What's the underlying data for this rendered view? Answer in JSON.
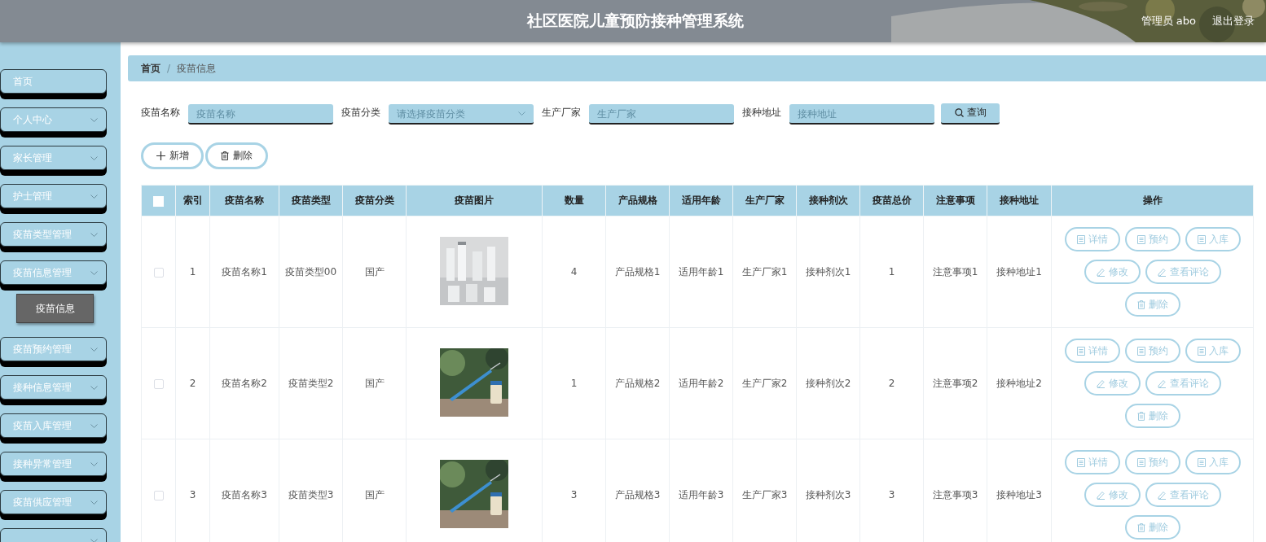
{
  "header": {
    "title": "社区医院儿童预防接种管理系统",
    "user": "管理员 abo",
    "logout": "退出登录"
  },
  "sidebar": {
    "items": [
      {
        "label": "首页",
        "kind": "link"
      },
      {
        "label": "个人中心",
        "kind": "menu"
      },
      {
        "label": "家长管理",
        "kind": "menu"
      },
      {
        "label": "护士管理",
        "kind": "menu"
      },
      {
        "label": "疫苗类型管理",
        "kind": "menu"
      },
      {
        "label": "疫苗信息管理",
        "kind": "menu",
        "children": [
          {
            "label": "疫苗信息",
            "selected": true
          }
        ]
      },
      {
        "label": "疫苗预约管理",
        "kind": "menu"
      },
      {
        "label": "接种信息管理",
        "kind": "menu"
      },
      {
        "label": "疫苗入库管理",
        "kind": "menu"
      },
      {
        "label": "接种异常管理",
        "kind": "menu"
      },
      {
        "label": "疫苗供应管理",
        "kind": "menu"
      },
      {
        "kind": "menu"
      }
    ]
  },
  "breadcrumb": {
    "items": [
      "首页",
      "疫苗信息"
    ],
    "separator": "/"
  },
  "search": {
    "fields": [
      {
        "label": "疫苗名称",
        "placeholder": "疫苗名称",
        "kind": "text"
      },
      {
        "label": "疫苗分类",
        "placeholder": "请选择疫苗分类",
        "kind": "select"
      },
      {
        "label": "生产厂家",
        "placeholder": "生产厂家",
        "kind": "text"
      },
      {
        "label": "接种地址",
        "placeholder": "接种地址",
        "kind": "text"
      }
    ],
    "button": "查询"
  },
  "toolbar": [
    {
      "label": "新增",
      "kind": "plus"
    },
    {
      "label": "删除",
      "kind": "trash"
    }
  ],
  "table": {
    "columns": [
      "索引",
      "疫苗名称",
      "疫苗类型",
      "疫苗分类",
      "疫苗图片",
      "数量",
      "产品规格",
      "适用年龄",
      "生产厂家",
      "接种剂次",
      "疫苗总价",
      "注意事项",
      "接种地址",
      "操作"
    ],
    "select_all": {
      "checked": false
    },
    "rows": [
      {
        "checked": false,
        "cells": [
          "1",
          "疫苗名称1",
          "疫苗类型00",
          "国产",
          {
            "kind": "picture"
          },
          "4",
          "产品规格1",
          "适用年龄1",
          "生产厂家1",
          "接种剂次1",
          "1",
          "注意事项1",
          "接种地址1"
        ],
        "actions": [
          {
            "label": "详情",
            "kind": "doc"
          },
          {
            "label": "预约",
            "kind": "doc"
          },
          {
            "label": "入库",
            "kind": "doc"
          },
          {
            "label": "修改",
            "kind": "pencil"
          },
          {
            "label": "查看评论",
            "kind": "pencil"
          },
          {
            "label": "删除",
            "kind": "trash"
          }
        ]
      },
      {
        "checked": false,
        "cells": [
          "2",
          "疫苗名称2",
          "疫苗类型2",
          "国产",
          {
            "kind": "picture"
          },
          "1",
          "产品规格2",
          "适用年龄2",
          "生产厂家2",
          "接种剂次2",
          "2",
          "注意事项2",
          "接种地址2"
        ],
        "actions": [
          {
            "label": "详情",
            "kind": "doc"
          },
          {
            "label": "预约",
            "kind": "doc"
          },
          {
            "label": "入库",
            "kind": "doc"
          },
          {
            "label": "修改",
            "kind": "pencil"
          },
          {
            "label": "查看评论",
            "kind": "pencil"
          },
          {
            "label": "删除",
            "kind": "trash"
          }
        ]
      },
      {
        "checked": false,
        "cells": [
          "3",
          "疫苗名称3",
          "疫苗类型3",
          "国产",
          {
            "kind": "picture"
          },
          "3",
          "产品规格3",
          "适用年龄3",
          "生产厂家3",
          "接种剂次3",
          "3",
          "注意事项3",
          "接种地址3"
        ],
        "actions": [
          {
            "label": "详情",
            "kind": "doc"
          },
          {
            "label": "预约",
            "kind": "doc"
          },
          {
            "label": "入库",
            "kind": "doc"
          },
          {
            "label": "修改",
            "kind": "pencil"
          },
          {
            "label": "查看评论",
            "kind": "pencil"
          },
          {
            "label": "删除",
            "kind": "trash"
          }
        ]
      }
    ]
  }
}
